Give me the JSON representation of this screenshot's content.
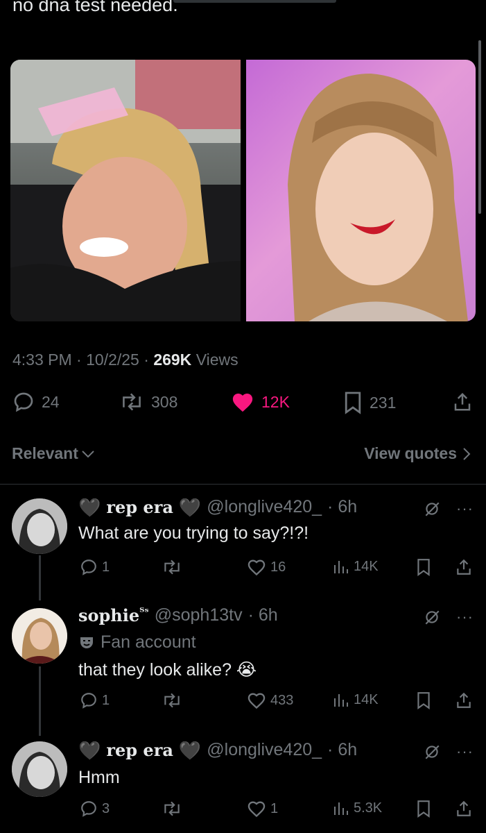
{
  "post": {
    "text": "no dna test needed.",
    "time": "4:33 PM",
    "date": "10/2/25",
    "views_count": "269K",
    "views_label": "Views",
    "separator": "·",
    "replies": "24",
    "reposts": "308",
    "likes": "12K",
    "bookmarks": "231"
  },
  "sort": {
    "label": "Relevant",
    "view_quotes": "View quotes"
  },
  "replies": [
    {
      "display_name": "rep era",
      "handle": "@longlive420_",
      "time": "· 6h",
      "text": "What are you trying to say?!?!",
      "replies": "1",
      "reposts": "",
      "likes": "16",
      "views": "14K"
    },
    {
      "display_name": "sophie",
      "name_suffix": "ᵀˢ",
      "handle": "@soph13tv",
      "time": "· 6h",
      "badge": "Fan account",
      "text": "that they look alike? 😭",
      "replies": "1",
      "reposts": "",
      "likes": "433",
      "views": "14K"
    },
    {
      "display_name": "rep era",
      "handle": "@longlive420_",
      "time": "· 6h",
      "text": "Hmm",
      "replies": "3",
      "reposts": "",
      "likes": "1",
      "views": "5.3K"
    }
  ],
  "icons": {
    "heart_emoji": "🖤",
    "like_color": "#f91880",
    "muted_color": "#71767b",
    "text_color": "#e7e9ea"
  }
}
